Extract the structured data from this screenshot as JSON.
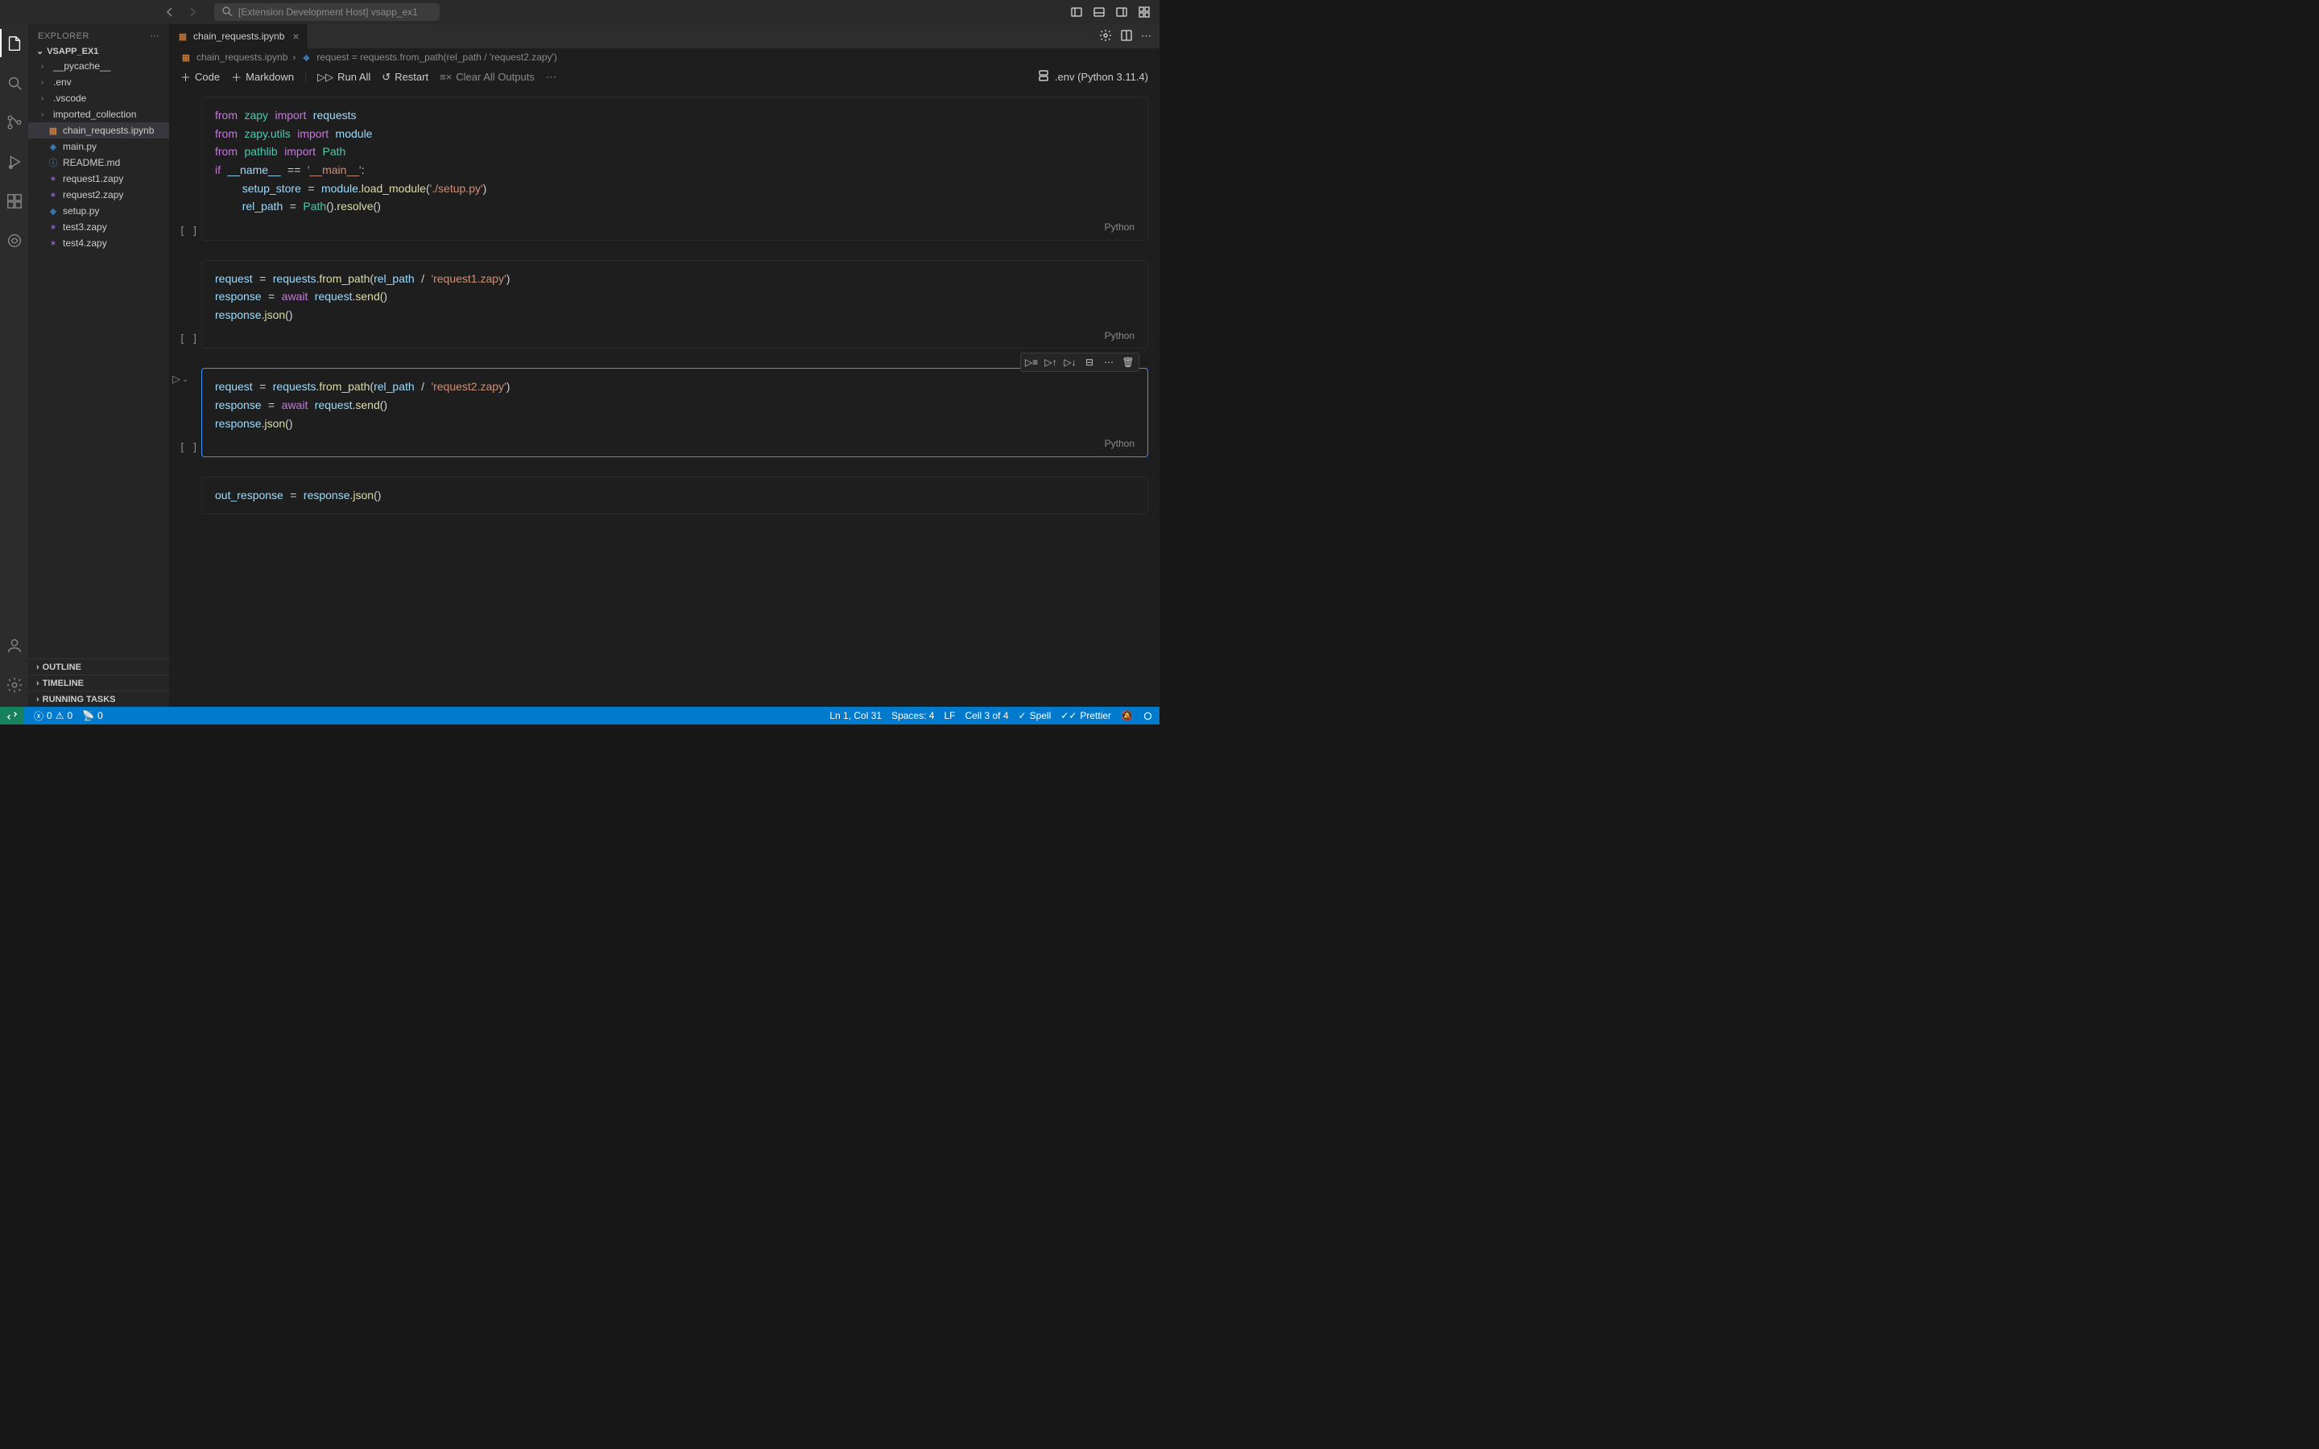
{
  "titlebar": {
    "search_text": "[Extension Development Host] vsapp_ex1"
  },
  "sidebar": {
    "title": "EXPLORER",
    "project": "VSAPP_EX1",
    "tree": [
      {
        "type": "folder",
        "name": "__pycache__"
      },
      {
        "type": "folder",
        "name": ".env"
      },
      {
        "type": "folder",
        "name": ".vscode"
      },
      {
        "type": "folder",
        "name": "imported_collection"
      },
      {
        "type": "file",
        "name": "chain_requests.ipynb",
        "icon": "nb",
        "selected": true
      },
      {
        "type": "file",
        "name": "main.py",
        "icon": "py"
      },
      {
        "type": "file",
        "name": "README.md",
        "icon": "md"
      },
      {
        "type": "file",
        "name": "request1.zapy",
        "icon": "zapy"
      },
      {
        "type": "file",
        "name": "request2.zapy",
        "icon": "zapy"
      },
      {
        "type": "file",
        "name": "setup.py",
        "icon": "py"
      },
      {
        "type": "file",
        "name": "test3.zapy",
        "icon": "zapy"
      },
      {
        "type": "file",
        "name": "test4.zapy",
        "icon": "zapy"
      }
    ],
    "panels": [
      "OUTLINE",
      "TIMELINE",
      "RUNNING TASKS"
    ]
  },
  "tabs": {
    "items": [
      {
        "name": "chain_requests.ipynb"
      }
    ]
  },
  "breadcrumb": {
    "file": "chain_requests.ipynb",
    "symbol": "request = requests.from_path(rel_path / 'request2.zapy')"
  },
  "nb_toolbar": {
    "code": "Code",
    "markdown": "Markdown",
    "run_all": "Run All",
    "restart": "Restart",
    "clear": "Clear All Outputs",
    "kernel": ".env (Python 3.11.4)"
  },
  "cells": [
    {
      "prompt": "[ ]",
      "lang": "Python",
      "code_html": "<span class='kw'>from</span> <span class='mod'>zapy</span> <span class='kw'>import</span> <span class='var'>requests</span>\n<span class='kw'>from</span> <span class='mod'>zapy.utils</span> <span class='kw'>import</span> <span class='var'>module</span>\n<span class='kw'>from</span> <span class='mod'>pathlib</span> <span class='kw'>import</span> <span class='ty'>Path</span>\n<span class='kw'>if</span> <span class='var'>__name__</span> <span class='op'>==</span> <span class='str'>'__main__'</span><span class='op'>:</span>\n    <span class='var'>setup_store</span> <span class='op'>=</span> <span class='var'>module</span><span class='op'>.</span><span class='fn'>load_module</span><span class='op'>(</span><span class='str'>'./setup.py'</span><span class='op'>)</span>\n    <span class='var'>rel_path</span> <span class='op'>=</span> <span class='ty'>Path</span><span class='op'>().</span><span class='fn'>resolve</span><span class='op'>()</span>"
    },
    {
      "prompt": "[ ]",
      "lang": "Python",
      "code_html": "<span class='var'>request</span> <span class='op'>=</span> <span class='var'>requests</span><span class='op'>.</span><span class='fn'>from_path</span><span class='op'>(</span><span class='var'>rel_path</span> <span class='op'>/</span> <span class='str'>'request1.zapy'</span><span class='op'>)</span>\n<span class='var'>response</span> <span class='op'>=</span> <span class='kw'>await</span> <span class='var'>request</span><span class='op'>.</span><span class='fn'>send</span><span class='op'>()</span>\n<span class='var'>response</span><span class='op'>.</span><span class='fn'>json</span><span class='op'>()</span>"
    },
    {
      "prompt": "[ ]",
      "lang": "Python",
      "active": true,
      "code_html": "<span class='var'>request</span> <span class='op'>=</span> <span class='var'>requests</span><span class='op'>.</span><span class='fn'>from_path</span><span class='op'>(</span><span class='var'>rel_path</span> <span class='op'>/</span> <span class='str'>'request2.zapy'</span><span class='op'>)</span>\n<span class='var'>response</span> <span class='op'>=</span> <span class='kw'>await</span> <span class='var'>request</span><span class='op'>.</span><span class='fn'>send</span><span class='op'>()</span>\n<span class='var'>response</span><span class='op'>.</span><span class='fn'>json</span><span class='op'>()</span>"
    },
    {
      "prompt": "",
      "lang": "",
      "code_html": "<span class='var'>out_response</span> <span class='op'>=</span> <span class='var'>response</span><span class='op'>.</span><span class='fn'>json</span><span class='op'>()</span>"
    }
  ],
  "statusbar": {
    "errors": "0",
    "warnings": "0",
    "ports": "0",
    "cursor": "Ln 1, Col 31",
    "spaces": "Spaces: 4",
    "eol": "LF",
    "cell": "Cell 3 of 4",
    "spell": "Spell",
    "prettier": "Prettier"
  }
}
